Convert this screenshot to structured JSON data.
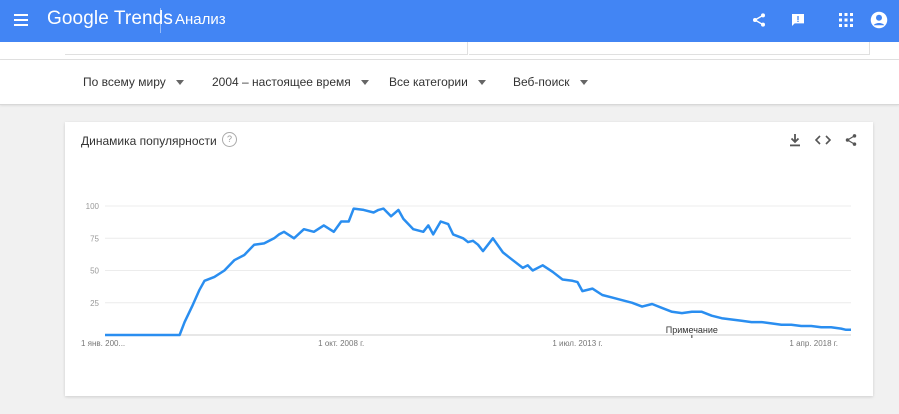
{
  "header": {
    "logo_text": "Google Trends",
    "page_title": "Анализ",
    "bg_color": "#4285f4",
    "icons": [
      "share-icon",
      "feedback-icon",
      "apps-icon",
      "account-icon"
    ]
  },
  "filters": [
    {
      "label": "По всему миру"
    },
    {
      "label": "2004 – настоящее время"
    },
    {
      "label": "Все категории"
    },
    {
      "label": "Веб-поиск"
    }
  ],
  "card": {
    "title": "Динамика популярности",
    "help_symbol": "?",
    "icons": [
      "download-icon",
      "embed-icon",
      "share-icon"
    ]
  },
  "chart_data": {
    "type": "line",
    "line_color": "#2a8ef0",
    "grid": true,
    "ylim": [
      0,
      100
    ],
    "y_ticks": [
      25,
      50,
      75,
      100
    ],
    "x_tick_labels": [
      "1 янв. 200...",
      "1 окт. 2008 г.",
      "1 июл. 2013 г.",
      "1 апр. 2018 г."
    ],
    "x_tick_dates": [
      2004.0,
      2008.75,
      2013.5,
      2018.25
    ],
    "xlim": [
      2004.0,
      2019.0
    ],
    "annotation": {
      "text": "Примечание",
      "x": 2015.8
    },
    "series": [
      {
        "x": [
          2004.0,
          2005.0,
          2005.5,
          2005.6,
          2005.75,
          2005.9,
          2006.0,
          2006.2,
          2006.4,
          2006.6,
          2006.8,
          2007.0,
          2007.2,
          2007.4,
          2007.5,
          2007.6,
          2007.8,
          2008.0,
          2008.2,
          2008.4,
          2008.6,
          2008.75,
          2008.9,
          2009.0,
          2009.2,
          2009.4,
          2009.5,
          2009.6,
          2009.75,
          2009.9,
          2010.0,
          2010.2,
          2010.4,
          2010.5,
          2010.6,
          2010.75,
          2010.9,
          2011.0,
          2011.2,
          2011.3,
          2011.4,
          2011.5,
          2011.6,
          2011.8,
          2012.0,
          2012.2,
          2012.4,
          2012.5,
          2012.6,
          2012.8,
          2013.0,
          2013.2,
          2013.4,
          2013.5,
          2013.6,
          2013.8,
          2014.0,
          2014.2,
          2014.4,
          2014.6,
          2014.8,
          2015.0,
          2015.2,
          2015.4,
          2015.6,
          2015.8,
          2016.0,
          2016.2,
          2016.4,
          2016.6,
          2016.8,
          2017.0,
          2017.2,
          2017.4,
          2017.6,
          2017.8,
          2018.0,
          2018.2,
          2018.4,
          2018.6,
          2018.8,
          2018.9,
          2019.0
        ],
        "y": [
          0,
          0,
          0,
          10,
          22,
          35,
          42,
          45,
          50,
          58,
          62,
          70,
          71,
          75,
          78,
          80,
          75,
          82,
          80,
          85,
          80,
          88,
          88,
          98,
          97,
          95,
          97,
          98,
          92,
          97,
          90,
          82,
          80,
          85,
          78,
          88,
          86,
          78,
          75,
          72,
          73,
          70,
          65,
          75,
          64,
          58,
          52,
          54,
          50,
          54,
          49,
          43,
          42,
          41,
          34,
          36,
          31,
          29,
          27,
          25,
          22,
          24,
          21,
          18,
          17,
          18,
          18,
          15,
          13,
          12,
          11,
          10,
          10,
          9,
          8,
          8,
          7,
          7,
          6,
          6,
          5,
          4,
          4
        ]
      }
    ]
  }
}
